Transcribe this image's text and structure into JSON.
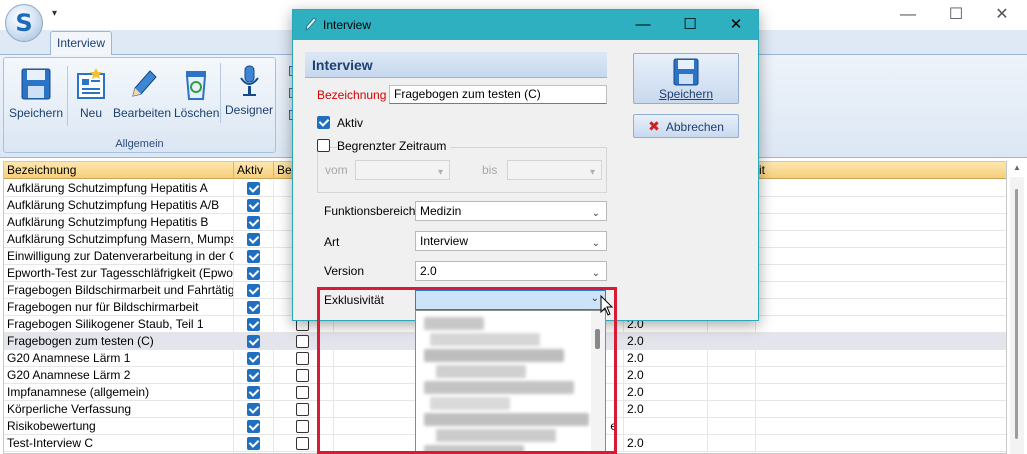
{
  "window": {
    "title": "",
    "qat_glyph": "▾",
    "logo_letter": "S"
  },
  "ribbon": {
    "tab": "Interview",
    "group_label": "Allgemein",
    "buttons": [
      {
        "label": "Speichern",
        "icon": "floppy-disk-icon"
      },
      {
        "label": "Neu",
        "icon": "new-form-icon"
      },
      {
        "label": "Bearbeiten",
        "icon": "pencil-icon"
      },
      {
        "label": "Löschen",
        "icon": "recycle-bin-icon"
      },
      {
        "label": "Designer",
        "icon": "microphone-icon"
      }
    ]
  },
  "grid": {
    "columns": [
      "Bezeichnung",
      "Aktiv",
      "Beg",
      "",
      "",
      "",
      "it"
    ],
    "rows": [
      {
        "name": "Aufklärung Schutzimpfung Hepatitis A",
        "aktiv": true,
        "version": ""
      },
      {
        "name": "Aufklärung Schutzimpfung Hepatitis A/B",
        "aktiv": true,
        "version": ""
      },
      {
        "name": "Aufklärung Schutzimpfung Hepatitis B",
        "aktiv": true,
        "version": ""
      },
      {
        "name": "Aufklärung Schutzimpfung Masern, Mumps, Röt",
        "aktiv": true,
        "version": ""
      },
      {
        "name": "Einwilligung zur Datenverarbeitung in der Gesun",
        "aktiv": true,
        "version": ""
      },
      {
        "name": "Epworth-Test zur Tagesschläfrigkeit (Epworth S",
        "aktiv": true,
        "version": ""
      },
      {
        "name": "Fragebogen Bildschirmarbeit und Fahrtätigkeit",
        "aktiv": true,
        "version": ""
      },
      {
        "name": "Fragebogen nur für Bildschirmarbeit",
        "aktiv": true,
        "version": ""
      },
      {
        "name": "Fragebogen Silikogener Staub, Teil 1",
        "aktiv": true,
        "version": "2.0"
      },
      {
        "name": "Fragebogen zum testen (C)",
        "aktiv": true,
        "version": "2.0"
      },
      {
        "name": "G20 Anamnese Lärm 1",
        "aktiv": true,
        "version": "2.0"
      },
      {
        "name": "G20 Anamnese Lärm 2",
        "aktiv": true,
        "version": "2.0"
      },
      {
        "name": "Impfanamnese (allgemein)",
        "aktiv": true,
        "version": "2.0"
      },
      {
        "name": "Körperliche Verfassung",
        "aktiv": true,
        "version": "2.0"
      },
      {
        "name": "Risikobewertung",
        "aktiv": true,
        "version": ""
      },
      {
        "name": "Test-Interview C",
        "aktiv": true,
        "version": "2.0"
      }
    ],
    "row_extra_e": "e"
  },
  "dialog": {
    "title": "Interview",
    "header": "Interview",
    "bezeichnung_label": "Bezeichnung",
    "bezeichnung_value": "Fragebogen zum testen (C)",
    "aktiv_label": "Aktiv",
    "aktiv_checked": true,
    "zeitraum_label": "Begrenzter Zeitraum",
    "zeitraum_checked": false,
    "vom_label": "vom",
    "bis_label": "bis",
    "funktionsbereich_label": "Funktionsbereich",
    "funktionsbereich_value": "Medizin",
    "art_label": "Art",
    "art_value": "Interview",
    "version_label": "Version",
    "version_value": "2.0",
    "exklusivitaet_label": "Exklusivität",
    "exklusivitaet_value": "",
    "save_label": "Speichern",
    "cancel_label": "Abbrechen",
    "ctl_min": "—",
    "ctl_max": "☐",
    "ctl_close": "✕"
  },
  "colors": {
    "accent": "#2fb0c0",
    "highlight": "#d81b35",
    "required": "#d40000",
    "grid_header": "#f6cf7b"
  }
}
